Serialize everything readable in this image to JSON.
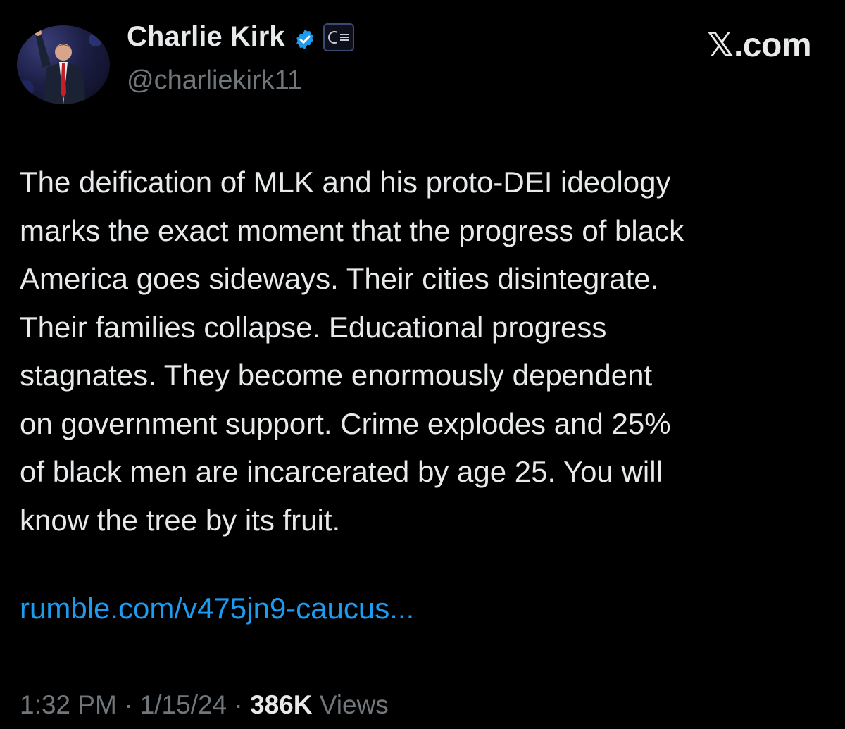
{
  "author": {
    "display_name": "Charlie Kirk",
    "handle": "@charliekirk11",
    "avatar_icon": "profile-photo",
    "verified_icon": "verified-badge-icon",
    "affiliation_icon": "organization-badge-icon"
  },
  "site": {
    "label": "𝕏.com"
  },
  "post": {
    "lines": [
      "The deification of MLK and his proto-DEI ideology",
      "marks the exact moment that the progress of black",
      "America goes sideways. Their cities disintegrate.",
      "Their families collapse. Educational progress",
      "stagnates. They become enormously dependent",
      "on government support. Crime explodes and 25%",
      "of black men are incarcerated by age 25. You will",
      "know the tree by its fruit."
    ],
    "link": "rumble.com/v475jn9-caucus..."
  },
  "meta": {
    "time": "1:32 PM",
    "separator": " · ",
    "date": "1/15/24",
    "views_count": "386K",
    "views_label": " Views"
  },
  "colors": {
    "background": "#000000",
    "text": "#e7e9ea",
    "secondary": "#71767b",
    "link": "#1d9bf0",
    "verified": "#1d9bf0"
  }
}
